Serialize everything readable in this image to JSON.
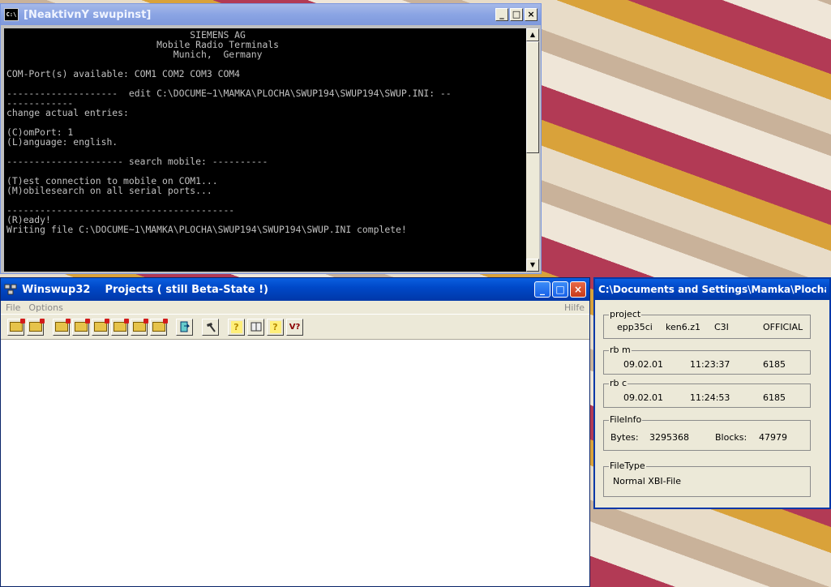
{
  "console": {
    "title": "[NeaktivnÝ swupinst]",
    "lines": [
      "                                 SIEMENS AG",
      "                           Mobile Radio Terminals",
      "                              Munich,  Germany",
      "",
      "COM-Port(s) available: COM1 COM2 COM3 COM4",
      "",
      "--------------------  edit C:\\DOCUME~1\\MAMKA\\PLOCHA\\SWUP194\\SWUP194\\SWUP.INI: --",
      "------------",
      "change actual entries:",
      "",
      "(C)omPort: 1",
      "(L)anguage: english.",
      "",
      "--------------------- search mobile: ----------",
      "",
      "(T)est connection to mobile on COM1...",
      "(M)obilesearch on all serial ports...",
      "",
      "-----------------------------------------",
      "(R)eady!",
      "Writing file C:\\DOCUME~1\\MAMKA\\PLOCHA\\SWUP194\\SWUP194\\SWUP.INI complete!"
    ]
  },
  "winswup": {
    "title": "Winswup32",
    "subtitle": "Projects ( still Beta-State !)",
    "menu": {
      "file": "File",
      "options": "Options",
      "help": "Hilfe"
    },
    "toolbar_version_label": "V?"
  },
  "info": {
    "title": "C:\\Documents and Settings\\Mamka\\Plocha\\...",
    "project": {
      "legend": "project",
      "name": "epp35ci",
      "version": "ken6.z1",
      "type": "C3I",
      "status": "OFFICIAL"
    },
    "rbm": {
      "legend": "rb m",
      "date": "09.02.01",
      "time": "11:23:37",
      "num": "6185"
    },
    "rbc": {
      "legend": "rb c",
      "date": "09.02.01",
      "time": "11:24:53",
      "num": "6185"
    },
    "fileinfo": {
      "legend": "FileInfo",
      "bytes_label": "Bytes:",
      "bytes": "3295368",
      "blocks_label": "Blocks:",
      "blocks": "47979"
    },
    "filetype": {
      "legend": "FileType",
      "value": "Normal XBI-File"
    }
  }
}
